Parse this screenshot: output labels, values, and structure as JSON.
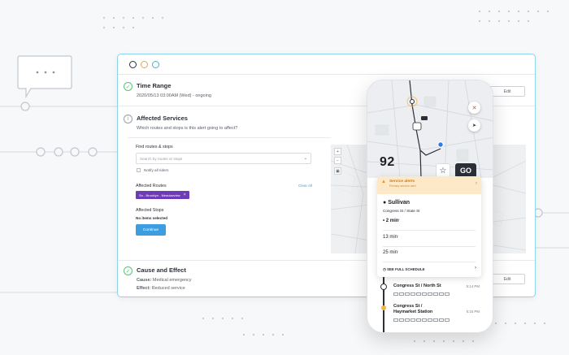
{
  "sections": {
    "time_range": {
      "title": "Time Range",
      "subtitle": "2020/05/13 03:00AM (Wed) - ongoing",
      "edit_label": "Edit"
    },
    "affected_services": {
      "title": "Affected Services",
      "subtitle": "Which routes and stops is this alert going to affect?",
      "find_label": "Find routes & stops",
      "search_placeholder": "Search by routes or stops",
      "notify_label": "Notify all riders",
      "affected_routes_label": "Affected Routes",
      "clear_all": "Clear All",
      "route_tag": "Sn - Brooklyn - Meadowview",
      "affected_stops_label": "Affected Stops",
      "no_items": "No items selected",
      "continue_label": "Continue"
    },
    "cause_effect": {
      "title": "Cause and Effect",
      "cause_label": "Cause:",
      "cause_value": "Medical emergency",
      "effect_label": "Effect:",
      "effect_value": "Reduced service",
      "edit_label": "Edit"
    }
  },
  "phone": {
    "route_number": "92",
    "go_label": "GO",
    "alert_title": "Service alerts",
    "alert_sub": "Primary service alert",
    "stop_name": "Sullivan",
    "stop_sub": "Congress St / State St",
    "times": [
      {
        "value": "2 min",
        "bold": true
      },
      {
        "value": "13 min",
        "bold": false
      },
      {
        "value": "25 min",
        "bold": false
      }
    ],
    "schedule_label": "SEE FULL SCHEDULE",
    "timeline": [
      {
        "name_line1": "Congress St / North St",
        "name_line2": "",
        "time": "5:14 PM"
      },
      {
        "name_line1": "Congress St /",
        "name_line2": "Haymarket Station",
        "time": "5:15 PM"
      }
    ]
  },
  "colors": {
    "accent_blue": "#3c9ee0",
    "route_tag": "#6c3bb5",
    "alert_bg": "#fde9c7",
    "success_green": "#5cc27a",
    "window_border": "#8dd4ec"
  }
}
